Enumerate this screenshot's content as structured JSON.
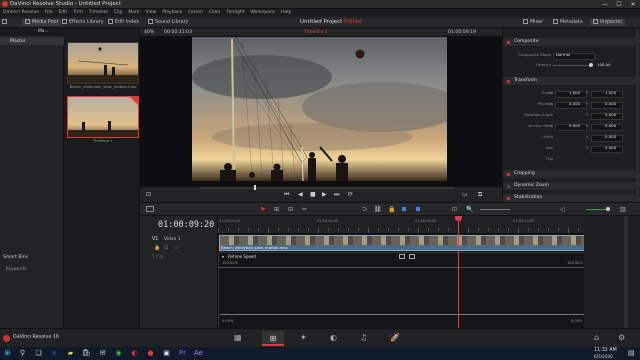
{
  "window": {
    "title": "DaVinci Resolve Studio - Untitled Project",
    "min": "—",
    "max": "☐",
    "close": "✕"
  },
  "menu": [
    "DaVinci Resolve",
    "File",
    "Edit",
    "Trim",
    "Timeline",
    "Clip",
    "Mark",
    "View",
    "Playback",
    "Fusion",
    "Color",
    "Fairlight",
    "Workspace",
    "Help"
  ],
  "toolbar": {
    "media_pool": "Media Pool",
    "effects_library": "Effects Library",
    "edit_index": "Edit Index",
    "sound_library": "Sound Library",
    "project_title": "Untitled Project",
    "edited": "Edited",
    "mixer": "Mixer",
    "metadata": "Metadata",
    "inspector": "Inspector"
  },
  "bins": {
    "master": "Master",
    "smart_bins": "Smart Bins",
    "keywords": "Keywords",
    "list_label": "Ma..."
  },
  "media_pool": {
    "clips": [
      {
        "name": "Beach_volleyball_slow_motion.mov"
      },
      {
        "name": "Timeline 1"
      }
    ]
  },
  "viewer": {
    "zoom": "40%",
    "source_tc": "00:00:31:03",
    "timeline_name": "Timeline 1",
    "record_tc": "01:00:09:19"
  },
  "inspector": {
    "sections": {
      "composite": "Composite",
      "transform": "Transform",
      "cropping": "Cropping",
      "dynamic_zoom": "Dynamic Zoom",
      "stabilization": "Stabilization"
    },
    "composite_mode_label": "Composite Mode",
    "composite_mode": "Normal",
    "opacity_label": "Opacity",
    "opacity": "100.00",
    "props": [
      {
        "label": "Zoom",
        "x": "1.000",
        "y": "1.000"
      },
      {
        "label": "Position",
        "x": "0.000",
        "y": "0.000"
      },
      {
        "label": "Rotation Angle",
        "x": "",
        "y": "0.000"
      },
      {
        "label": "Anchor Point",
        "x": "0.000",
        "y": "0.000"
      },
      {
        "label": "Pitch",
        "x": "",
        "y": "0.000"
      },
      {
        "label": "Yaw",
        "x": "",
        "y": "0.000"
      },
      {
        "label": "Flip",
        "x": "",
        "y": ""
      }
    ],
    "prop_letters": [
      "X",
      "Y"
    ]
  },
  "timeline": {
    "timecode": "01:00:09:20",
    "track_name": "V1",
    "track_label": "Video 1",
    "audio_label": "1 Clip",
    "ruler": [
      "01:00:00:00",
      "01:00:04:00",
      "01:00:08:00",
      "01:00:12:00"
    ],
    "clip_name": "Beach_volleyball_slow_motion.mov",
    "retime_label": "Retime Speed",
    "retime_left": "100.00%",
    "retime_right": "100.00%",
    "retime_bottom_left": "0.00%",
    "retime_bottom_right": "0.00%"
  },
  "taskbar": {
    "time": "11:32 AM",
    "date": "6/5/2020"
  },
  "app_version": "DaVinci Resolve 16",
  "colors": {
    "accent": "#e03a3a",
    "clip": "#4c6c8c",
    "bg": "#1f1f22"
  }
}
